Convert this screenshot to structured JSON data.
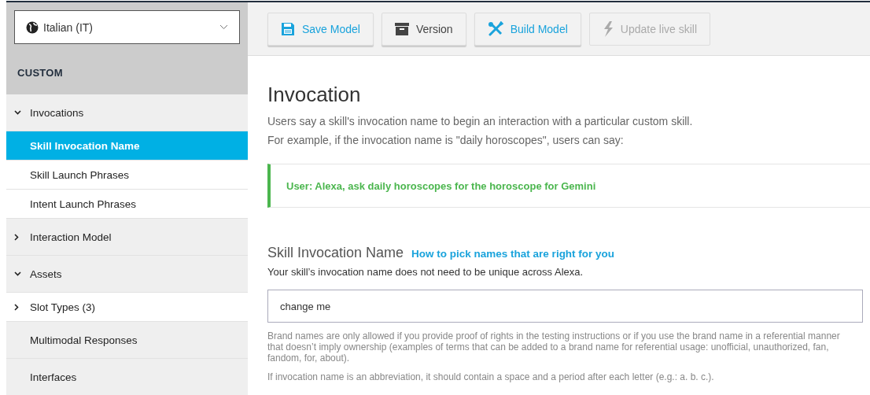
{
  "locale": {
    "label": "Italian (IT)"
  },
  "sidebar": {
    "heading": "CUSTOM",
    "items": [
      {
        "label": "Invocations",
        "kind": "section",
        "expanded": true,
        "selected": false
      },
      {
        "label": "Skill Invocation Name",
        "kind": "page",
        "selected": true
      },
      {
        "label": "Skill Launch Phrases",
        "kind": "page",
        "selected": false
      },
      {
        "label": "Intent Launch Phrases",
        "kind": "page",
        "selected": false
      },
      {
        "label": "Interaction Model",
        "kind": "section",
        "expanded": false,
        "selected": false
      },
      {
        "label": "Assets",
        "kind": "section",
        "expanded": true,
        "selected": false
      },
      {
        "label": "Slot Types (3)",
        "kind": "page",
        "expanded": false,
        "selected": false
      },
      {
        "label": "Multimodal Responses",
        "kind": "section",
        "selected": false
      },
      {
        "label": "Interfaces",
        "kind": "section",
        "selected": false
      }
    ]
  },
  "toolbar": [
    {
      "label": "Save Model",
      "kind": "save",
      "disabled": false
    },
    {
      "label": "Version",
      "kind": "archive",
      "disabled": false
    },
    {
      "label": "Build Model",
      "kind": "build",
      "disabled": false
    },
    {
      "label": "Update live skill",
      "kind": "publish",
      "disabled": true
    }
  ],
  "page": {
    "title": "Invocation",
    "intro": [
      "Users say a skill's invocation name to begin an interaction with a particular custom skill.",
      "For example, if the invocation name is \"daily horoscopes\", users can say:"
    ],
    "example": "User: Alexa, ask daily horoscopes for the horoscope for Gemini",
    "field_title": "Skill Invocation Name",
    "help_link": "How to pick names that are right for you",
    "field_subtitle": "Your skill’s invocation name does not need to be unique across Alexa.",
    "field_value": "change me",
    "notes": [
      "Brand names are only allowed if you provide proof of rights in the testing instructions or if you use the brand name in a referential manner that doesn’t imply ownership (examples of terms that can be added to a brand name for referential usage: unofficial, unauthorized, fan, fandom, for, about).",
      "If invocation name is an abbreviation, it should contain a space and a period after each letter (e.g.: a. b. c.)."
    ]
  }
}
